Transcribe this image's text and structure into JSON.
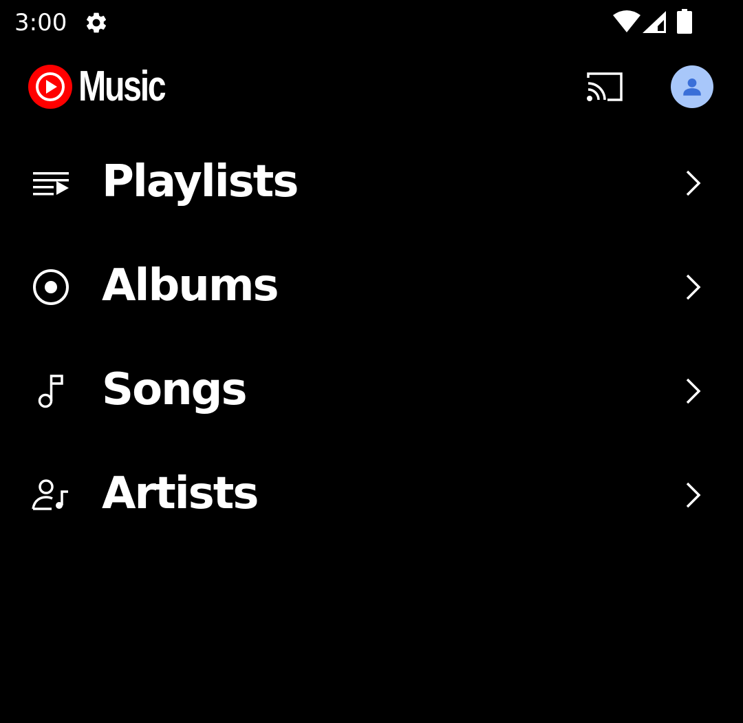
{
  "status_bar": {
    "time": "3:00",
    "icons": [
      "settings-gear-icon",
      "wifi-icon",
      "cell-signal-icon",
      "battery-icon"
    ]
  },
  "app_bar": {
    "logo_text": "Music",
    "logo_icon": "youtube-music-logo-icon",
    "cast_icon": "cast-icon",
    "avatar_icon": "account-avatar-icon"
  },
  "library": {
    "items": [
      {
        "label": "Playlists",
        "icon": "playlist-icon"
      },
      {
        "label": "Albums",
        "icon": "album-icon"
      },
      {
        "label": "Songs",
        "icon": "music-note-icon"
      },
      {
        "label": "Artists",
        "icon": "artist-icon"
      }
    ]
  },
  "colors": {
    "background": "#000000",
    "text": "#ffffff",
    "brand_red": "#ff0000",
    "avatar_bg": "#a8c7fa",
    "avatar_fg": "#3a6fd8"
  }
}
